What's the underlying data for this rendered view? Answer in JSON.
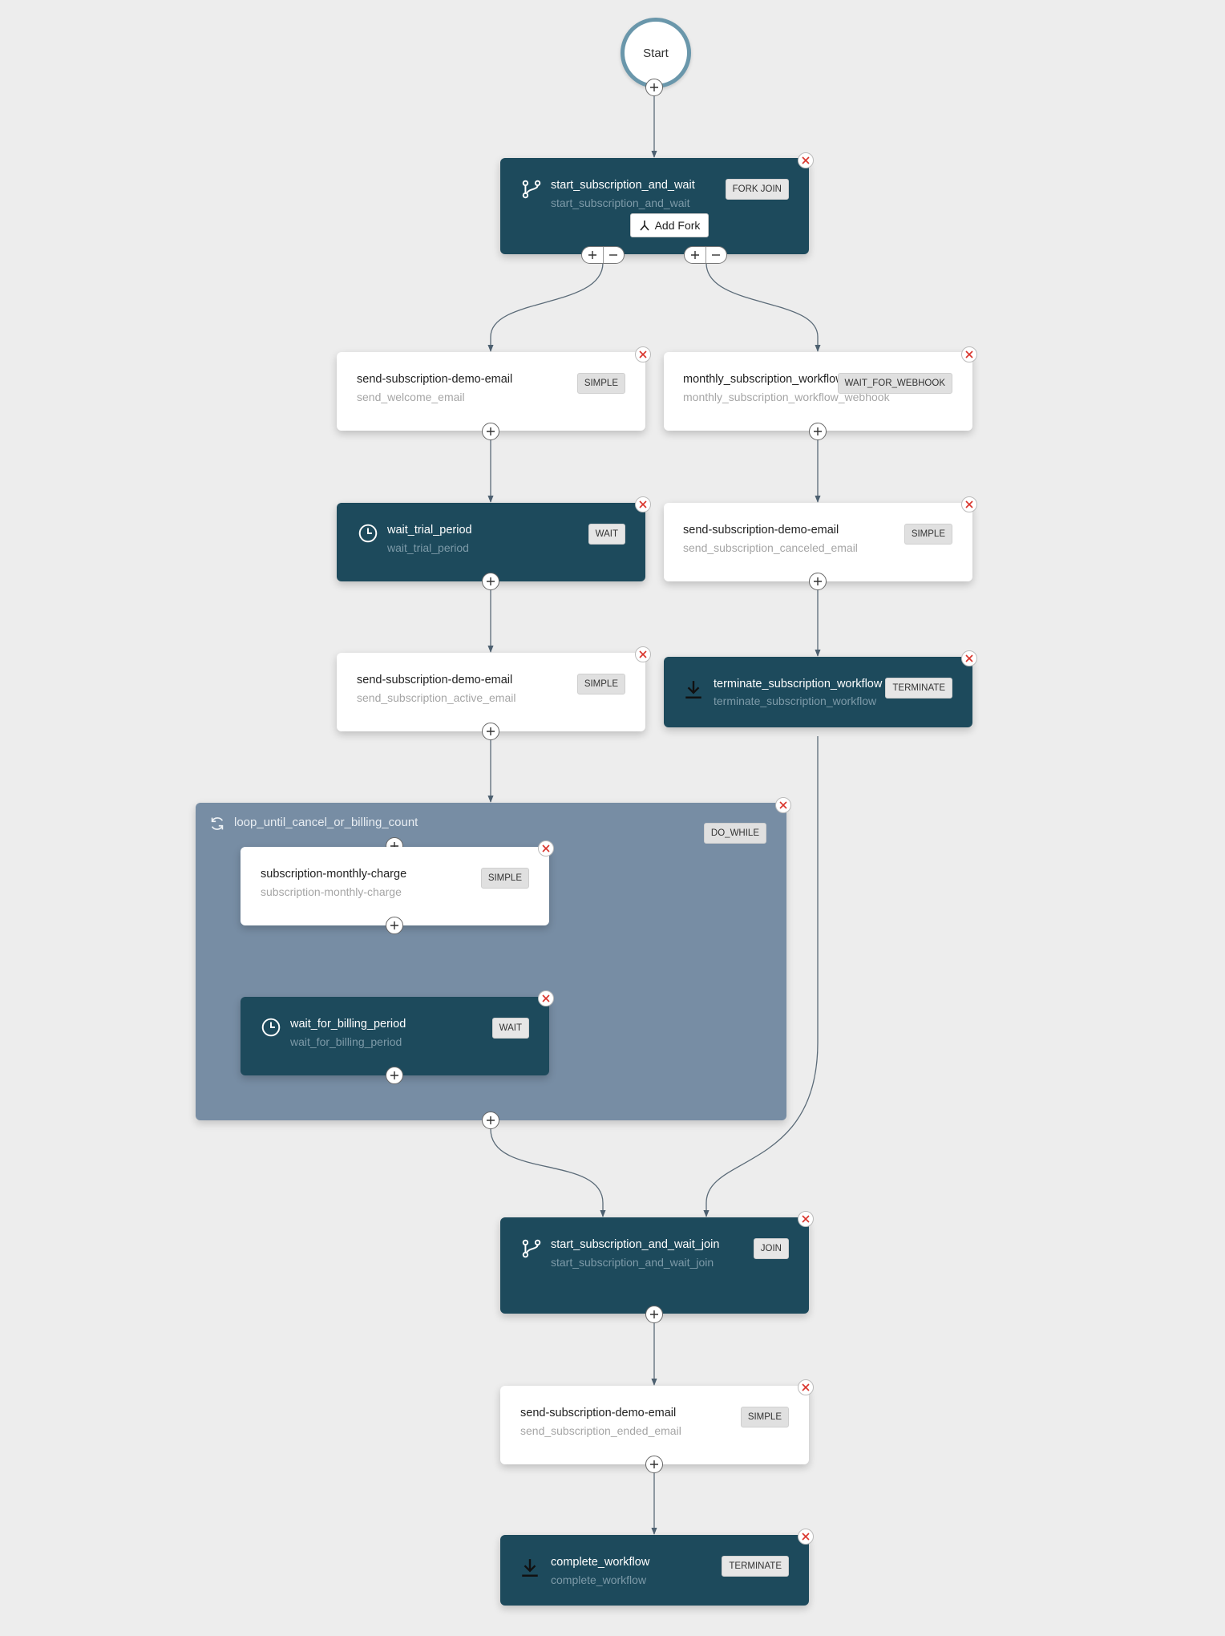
{
  "start": {
    "label": "Start"
  },
  "fork": {
    "title": "start_subscription_and_wait",
    "sub": "start_subscription_and_wait",
    "badge": "FORK JOIN",
    "add_fork_label": "Add Fork"
  },
  "left_branch": [
    {
      "title": "send-subscription-demo-email",
      "sub": "send_welcome_email",
      "badge": "SIMPLE"
    },
    {
      "title": "wait_trial_period",
      "sub": "wait_trial_period",
      "badge": "WAIT"
    },
    {
      "title": "send-subscription-demo-email",
      "sub": "send_subscription_active_email",
      "badge": "SIMPLE"
    }
  ],
  "right_branch": [
    {
      "title": "monthly_subscription_workflow",
      "sub": "monthly_subscription_workflow_webhook",
      "badge": "WAIT_FOR_WEBHOOK"
    },
    {
      "title": "send-subscription-demo-email",
      "sub": "send_subscription_canceled_email",
      "badge": "SIMPLE"
    },
    {
      "title": "terminate_subscription_workflow",
      "sub": "terminate_subscription_workflow",
      "badge": "TERMINATE"
    }
  ],
  "loop": {
    "title": "loop_until_cancel_or_billing_count",
    "badge": "DO_WHILE",
    "tasks": [
      {
        "title": "subscription-monthly-charge",
        "sub": "subscription-monthly-charge",
        "badge": "SIMPLE"
      },
      {
        "title": "wait_for_billing_period",
        "sub": "wait_for_billing_period",
        "badge": "WAIT"
      }
    ]
  },
  "join": {
    "title": "start_subscription_and_wait_join",
    "sub": "start_subscription_and_wait_join",
    "badge": "JOIN"
  },
  "ended_email": {
    "title": "send-subscription-demo-email",
    "sub": "send_subscription_ended_email",
    "badge": "SIMPLE"
  },
  "complete": {
    "title": "complete_workflow",
    "sub": "complete_workflow",
    "badge": "TERMINATE"
  },
  "colors": {
    "dark_node": "#1d4a5c",
    "loop_bg": "#778da4",
    "canvas": "#ededed",
    "close_x": "#d9342b",
    "start_ring": "#6a97ab"
  },
  "icons": {
    "fork": "fork-icon",
    "join": "fork-icon",
    "wait": "clock-icon",
    "terminate": "download-icon",
    "loop": "refresh-icon",
    "close": "close-icon",
    "add": "plus-icon",
    "remove": "minus-icon"
  }
}
